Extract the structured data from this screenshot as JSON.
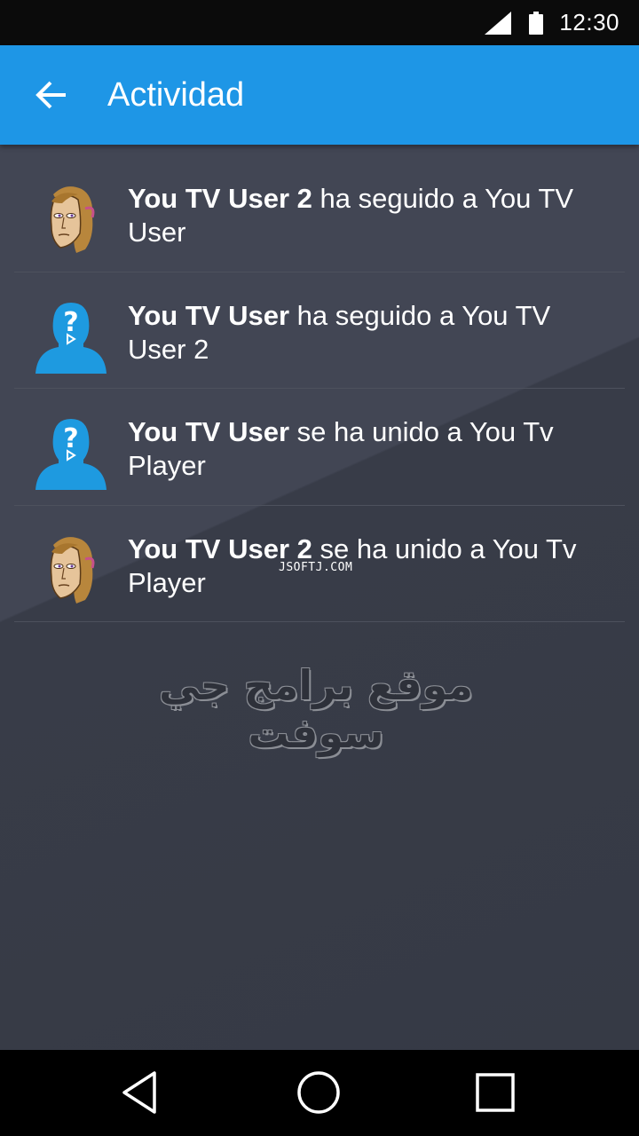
{
  "status_bar": {
    "time": "12:30"
  },
  "app_bar": {
    "title": "Actividad"
  },
  "activity": [
    {
      "user": "You TV User 2",
      "action": " ha seguido a You TV User",
      "avatar": "cartoon-man-avatar-icon"
    },
    {
      "user": "You TV User",
      "action": " ha seguido a You TV User 2",
      "avatar": "default-user-avatar-icon"
    },
    {
      "user": "You TV User",
      "action": " se ha unido a You Tv Player",
      "avatar": "default-user-avatar-icon"
    },
    {
      "user": "You TV User 2",
      "action": " se ha unido a You Tv Player",
      "avatar": "cartoon-man-avatar-icon"
    }
  ],
  "watermark": {
    "small": "JSOFTJ.COM",
    "arabic": "موقع برامج جي سوفت"
  },
  "colors": {
    "app_bar": "#1e96e6",
    "background": "#363a45",
    "avatar_blue": "#1e9ae0"
  }
}
